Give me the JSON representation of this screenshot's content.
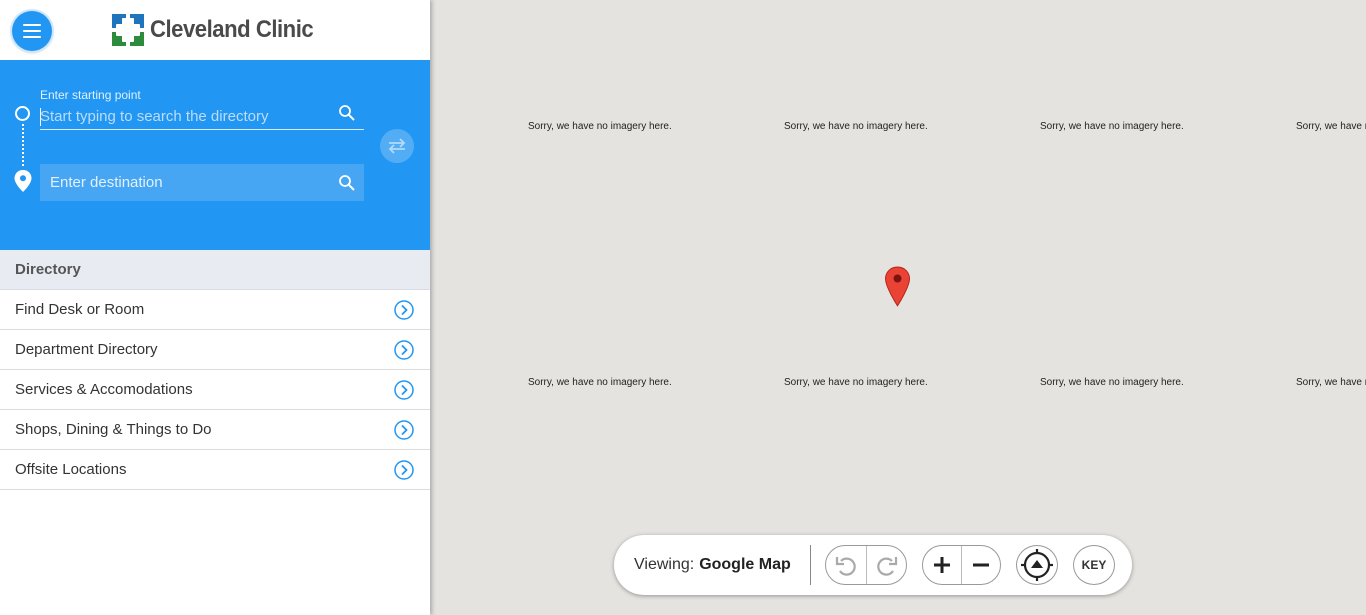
{
  "header": {
    "menu_icon": "hamburger-menu-icon",
    "logo_text": "Cleveland Clinic",
    "logo_colors": {
      "blue": "#1f75bb",
      "green": "#2e8b3c"
    }
  },
  "search": {
    "start_label": "Enter starting point",
    "start_placeholder": "Start typing to search the directory",
    "destination_placeholder": "Enter destination",
    "accent_color": "#2196f3"
  },
  "directory": {
    "header": "Directory",
    "items": [
      {
        "label": "Find Desk or Room"
      },
      {
        "label": "Department Directory"
      },
      {
        "label": "Services & Accomodations"
      },
      {
        "label": "Shops, Dining & Things to Do"
      },
      {
        "label": "Offsite Locations"
      }
    ]
  },
  "map": {
    "no_imagery_text": "Sorry, we have no imagery here.",
    "marker_color": "#ea4335"
  },
  "controls": {
    "viewing_label": "Viewing:",
    "viewing_value": "Google Map",
    "key_label": "KEY"
  }
}
